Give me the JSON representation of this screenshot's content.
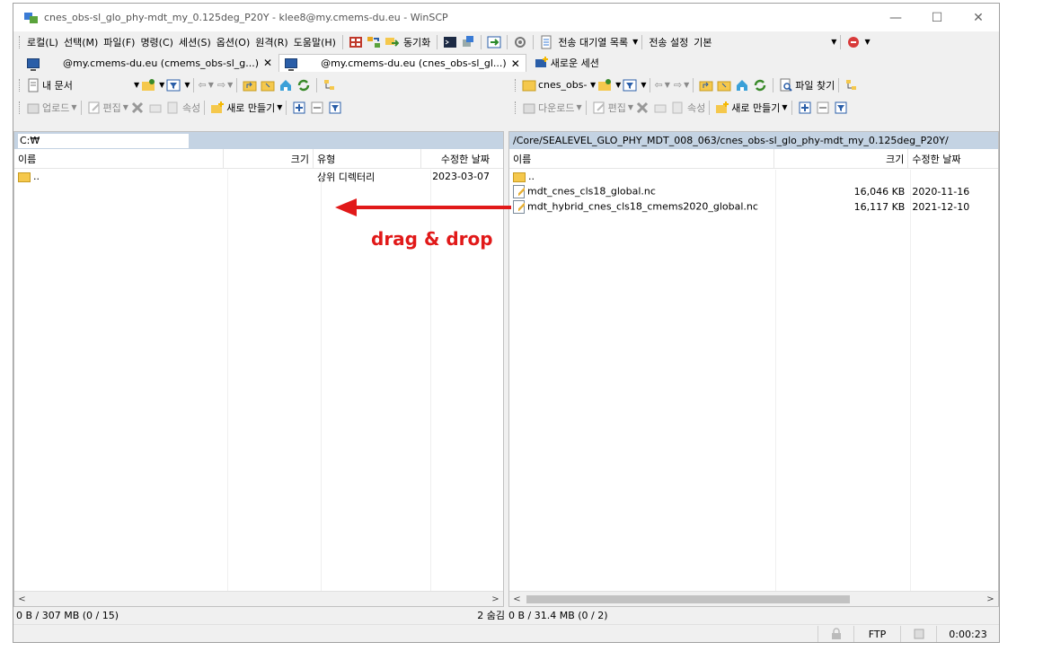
{
  "window": {
    "title": "cnes_obs-sl_glo_phy-mdt_my_0.125deg_P20Y - klee8@my.cmems-du.eu - WinSCP",
    "minimize": "—",
    "maximize": "☐",
    "close": "✕"
  },
  "menu": {
    "items": [
      "로컬(L)",
      "선택(M)",
      "파일(F)",
      "명령(C)",
      "세션(S)",
      "옵션(O)",
      "원격(R)",
      "도움말(H)"
    ],
    "sync_label": "동기화",
    "queue_label": "전송 대기열 목록",
    "transfer_settings_label": "전송 설정",
    "transfer_preset": "기본"
  },
  "tabs": [
    {
      "label": "@my.cmems-du.eu (cmems_obs-sl_g...)",
      "close": "✕"
    },
    {
      "label": "@my.cmems-du.eu (cnes_obs-sl_gl...)",
      "close": "✕"
    },
    {
      "label": "새로운 세션"
    }
  ],
  "left": {
    "location": "내 문서",
    "upload_label": "업로드",
    "edit_label": "편집",
    "props_label": "속성",
    "new_label": "새로 만들기",
    "path": "C:₩",
    "columns": {
      "name": "이름",
      "size": "크기",
      "type": "유형",
      "modified": "수정한 날짜"
    },
    "rows": [
      {
        "name": "..",
        "size": "",
        "type": "상위 디렉터리",
        "modified": "2023-03-07"
      }
    ],
    "status": "0 B / 307 MB (0 / 15)",
    "hidden": "2 숨김"
  },
  "right": {
    "location": "cnes_obs-",
    "download_label": "다운로드",
    "edit_label": "편집",
    "props_label": "속성",
    "new_label": "새로 만들기",
    "find_label": "파일 찾기",
    "path": "/Core/SEALEVEL_GLO_PHY_MDT_008_063/cnes_obs-sl_glo_phy-mdt_my_0.125deg_P20Y/",
    "columns": {
      "name": "이름",
      "size": "크기",
      "modified": "수정한 날짜"
    },
    "rows": [
      {
        "name": "..",
        "size": "",
        "modified": ""
      },
      {
        "name": "mdt_cnes_cls18_global.nc",
        "size": "16,046 KB",
        "modified": "2020-11-16"
      },
      {
        "name": "mdt_hybrid_cnes_cls18_cmems2020_global.nc",
        "size": "16,117 KB",
        "modified": "2021-12-10"
      }
    ],
    "status": "0 B / 31.4 MB (0 / 2)"
  },
  "bottom": {
    "protocol": "FTP",
    "elapsed": "0:00:23"
  },
  "annotation": {
    "text": "drag & drop",
    "color": "#e11919"
  }
}
